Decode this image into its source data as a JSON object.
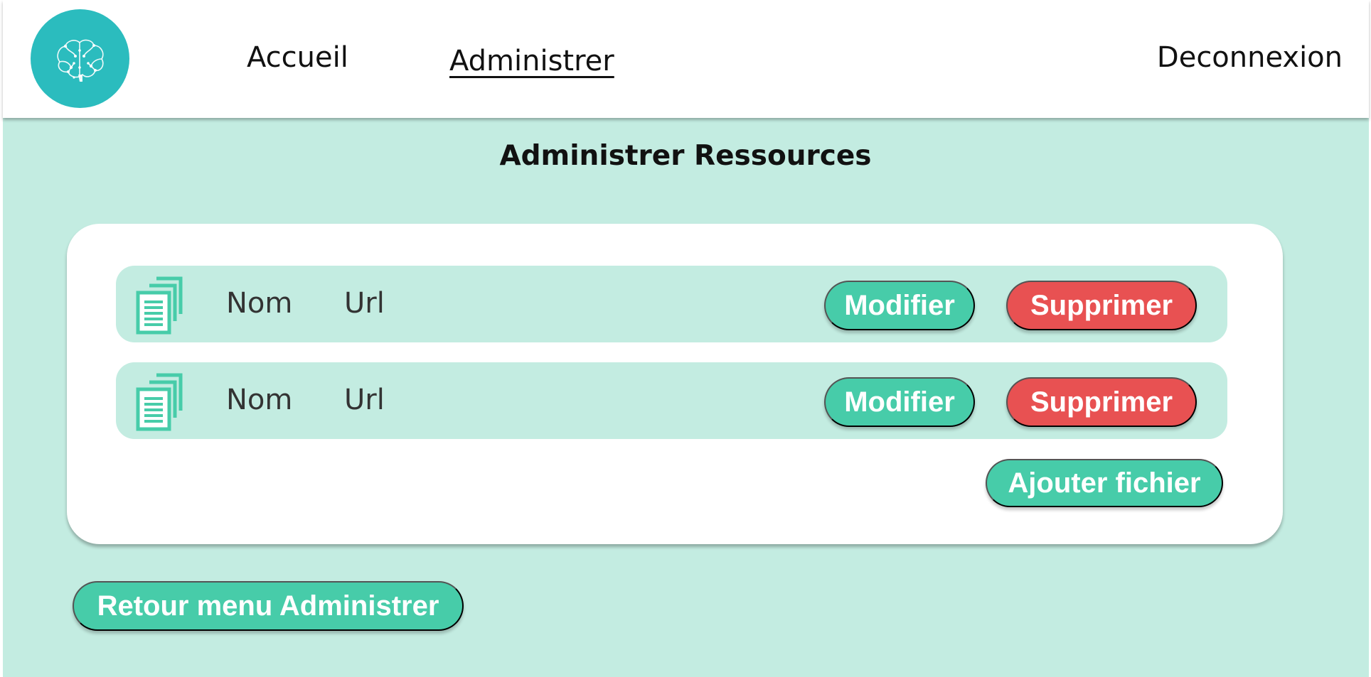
{
  "header": {
    "logo_icon": "brain-icon",
    "nav": {
      "home_label": "Accueil",
      "admin_label": "Administrer",
      "logout_label": "Deconnexion"
    }
  },
  "page": {
    "title": "Administrer Ressources"
  },
  "resources": {
    "rows": [
      {
        "icon": "document-stack-icon",
        "name": "Nom",
        "url": "Url",
        "edit_label": "Modifier",
        "delete_label": "Supprimer"
      },
      {
        "icon": "document-stack-icon",
        "name": "Nom",
        "url": "Url",
        "edit_label": "Modifier",
        "delete_label": "Supprimer"
      }
    ],
    "add_label": "Ajouter fichier"
  },
  "footer": {
    "back_label": "Retour menu Administrer"
  },
  "colors": {
    "background": "#c3ece1",
    "logo": "#2bbcbe",
    "primary_button": "#47cca9",
    "danger_button": "#e85152",
    "icon": "#47cca9"
  }
}
